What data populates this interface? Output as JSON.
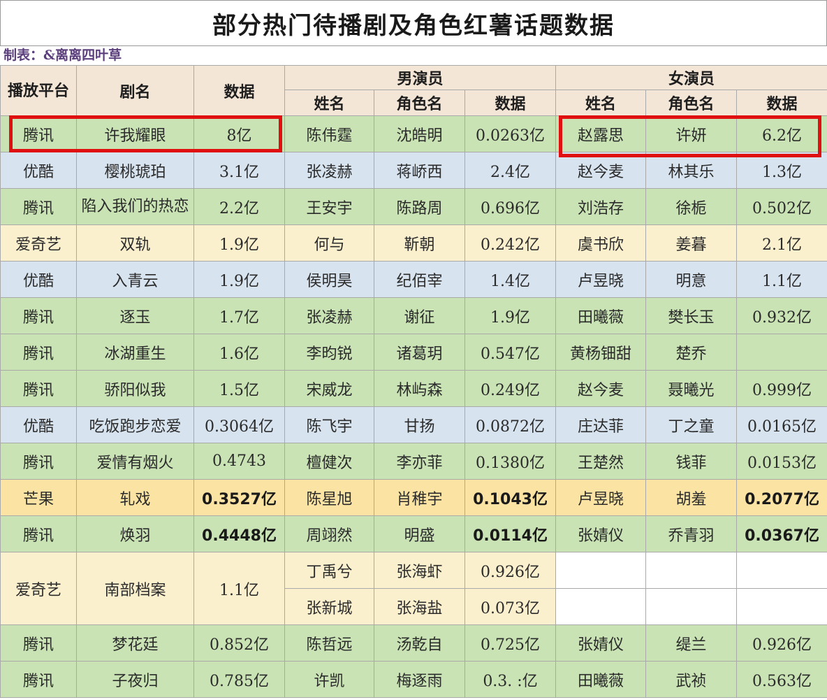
{
  "title": "部分热门待播剧及角色红薯话题数据",
  "maker": "制表：&离离四叶草",
  "headers": {
    "platform": "播放平台",
    "drama": "剧名",
    "data": "数据",
    "male_group": "男演员",
    "female_group": "女演员",
    "name": "姓名",
    "role": "角色名",
    "value": "数据"
  },
  "rows": [
    {
      "platform": "腾讯",
      "drama": "许我耀眼",
      "data": "8亿",
      "m_name": "陈伟霆",
      "m_role": "沈皓明",
      "m_data": "0.0263亿",
      "f_name": "赵露思",
      "f_role": "许妍",
      "f_data": "6.2亿"
    },
    {
      "platform": "优酷",
      "drama": "樱桃琥珀",
      "data": "3.1亿",
      "m_name": "张凌赫",
      "m_role": "蒋峤西",
      "m_data": "2.4亿",
      "f_name": "赵今麦",
      "f_role": "林其乐",
      "f_data": "1.3亿"
    },
    {
      "platform": "腾讯",
      "drama": "陷入我们的热恋",
      "data": "2.2亿",
      "m_name": "王安宇",
      "m_role": "陈路周",
      "m_data": "0.696亿",
      "f_name": "刘浩存",
      "f_role": "徐栀",
      "f_data": "0.502亿"
    },
    {
      "platform": "爱奇艺",
      "drama": "双轨",
      "data": "1.9亿",
      "m_name": "何与",
      "m_role": "靳朝",
      "m_data": "0.242亿",
      "f_name": "虞书欣",
      "f_role": "姜暮",
      "f_data": "2.1亿"
    },
    {
      "platform": "优酷",
      "drama": "入青云",
      "data": "1.9亿",
      "m_name": "侯明昊",
      "m_role": "纪佰宰",
      "m_data": "1.4亿",
      "f_name": "卢昱晓",
      "f_role": "明意",
      "f_data": "1.1亿"
    },
    {
      "platform": "腾讯",
      "drama": "逐玉",
      "data": "1.7亿",
      "m_name": "张凌赫",
      "m_role": "谢征",
      "m_data": "1.9亿",
      "f_name": "田曦薇",
      "f_role": "樊长玉",
      "f_data": "0.932亿"
    },
    {
      "platform": "腾讯",
      "drama": "冰湖重生",
      "data": "1.6亿",
      "m_name": "李昀锐",
      "m_role": "诸葛玥",
      "m_data": "0.547亿",
      "f_name": "黄杨钿甜",
      "f_role": "楚乔",
      "f_data": ""
    },
    {
      "platform": "腾讯",
      "drama": "骄阳似我",
      "data": "1.5亿",
      "m_name": "宋威龙",
      "m_role": "林屿森",
      "m_data": "0.249亿",
      "f_name": "赵今麦",
      "f_role": "聂曦光",
      "f_data": "0.999亿"
    },
    {
      "platform": "优酷",
      "drama": "吃饭跑步恋爱",
      "data": "0.3064亿",
      "m_name": "陈飞宇",
      "m_role": "甘扬",
      "m_data": "0.0872亿",
      "f_name": "庄达菲",
      "f_role": "丁之童",
      "f_data": "0.0165亿"
    },
    {
      "platform": "腾讯",
      "drama": "爱情有烟火",
      "data": "0.4743",
      "m_name": "檀健次",
      "m_role": "李亦菲",
      "m_data": "0.1380亿",
      "f_name": "王楚然",
      "f_role": "钱菲",
      "f_data": "0.0153亿"
    },
    {
      "platform": "芒果",
      "drama": "轧戏",
      "data": "0.3527亿",
      "m_name": "陈星旭",
      "m_role": "肖稚宇",
      "m_data": "0.1043亿",
      "f_name": "卢昱晓",
      "f_role": "胡羞",
      "f_data": "0.2077亿"
    },
    {
      "platform": "腾讯",
      "drama": "焕羽",
      "data": "0.4448亿",
      "m_name": "周翊然",
      "m_role": "明盛",
      "m_data": "0.0114亿",
      "f_name": "张婧仪",
      "f_role": "乔青羽",
      "f_data": "0.0367亿"
    },
    {
      "platform": "爱奇艺",
      "drama": "南部档案",
      "data": "1.1亿",
      "m_name": "丁禹兮",
      "m_role": "张海虾",
      "m_data": "0.926亿",
      "m_name2": "张新城",
      "m_role2": "张海盐",
      "m_data2": "0.073亿"
    },
    {
      "platform": "腾讯",
      "drama": "梦花廷",
      "data": "0.852亿",
      "m_name": "陈哲远",
      "m_role": "汤乾自",
      "m_data": "0.725亿",
      "f_name": "张婧仪",
      "f_role": "缇兰",
      "f_data": "0.926亿"
    },
    {
      "platform": "腾讯",
      "drama": "子夜归",
      "data": "0.785亿",
      "m_name": "许凯",
      "m_role": "梅逐雨",
      "m_data": "0.3.  :亿",
      "f_name": "田曦薇",
      "f_role": "武祯",
      "f_data": "0.563亿"
    }
  ],
  "colors": {
    "green": "#c9e3b4",
    "blue": "#d7e3ef",
    "cream": "#fbf0cd",
    "orange": "#fbe3a3",
    "header": "#f4e6d6",
    "highlight": "#e01010"
  }
}
